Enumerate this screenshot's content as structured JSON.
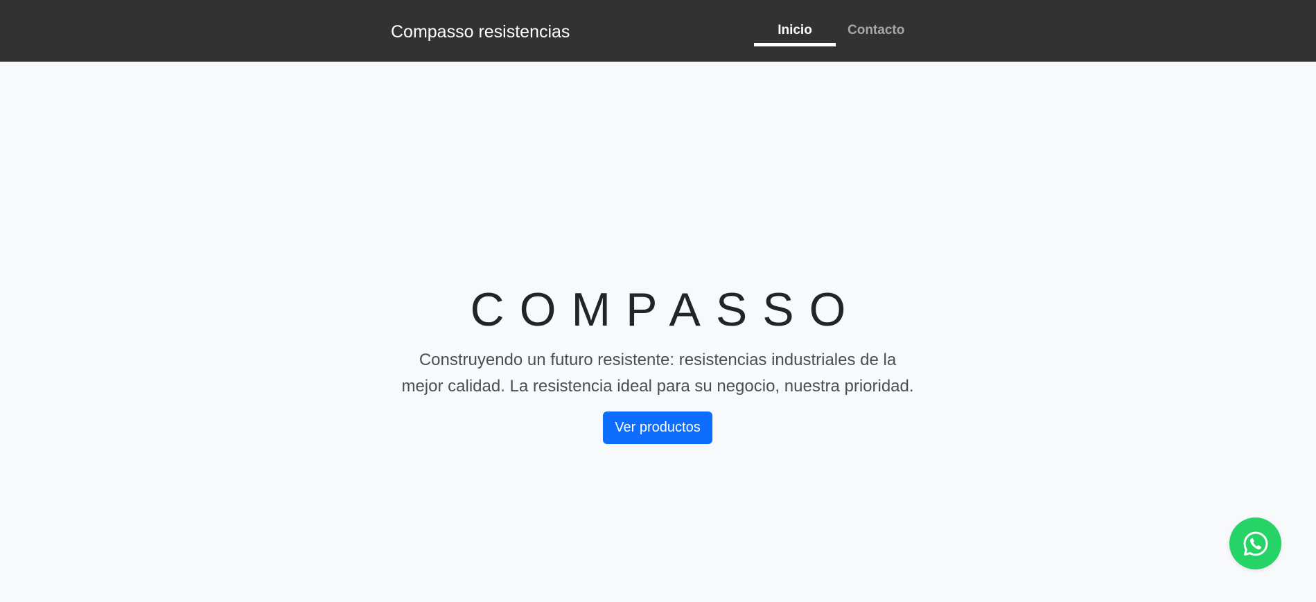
{
  "navbar": {
    "brand": "Compasso resistencias",
    "links": [
      {
        "label": "Inicio",
        "active": true
      },
      {
        "label": "Contacto",
        "active": false
      }
    ]
  },
  "hero": {
    "title": "COMPASSO",
    "lead": "Construyendo un futuro resistente: resistencias industriales de la mejor calidad. La resistencia ideal para su negocio, nuestra prioridad.",
    "cta_label": "Ver productos"
  },
  "floating": {
    "icon": "whatsapp-icon"
  },
  "colors": {
    "navbar_bg": "#323232",
    "page_bg": "#f8f9fb",
    "primary": "#0d6efd",
    "whatsapp": "#25d366",
    "nav_inactive": "#a7a7a7"
  }
}
